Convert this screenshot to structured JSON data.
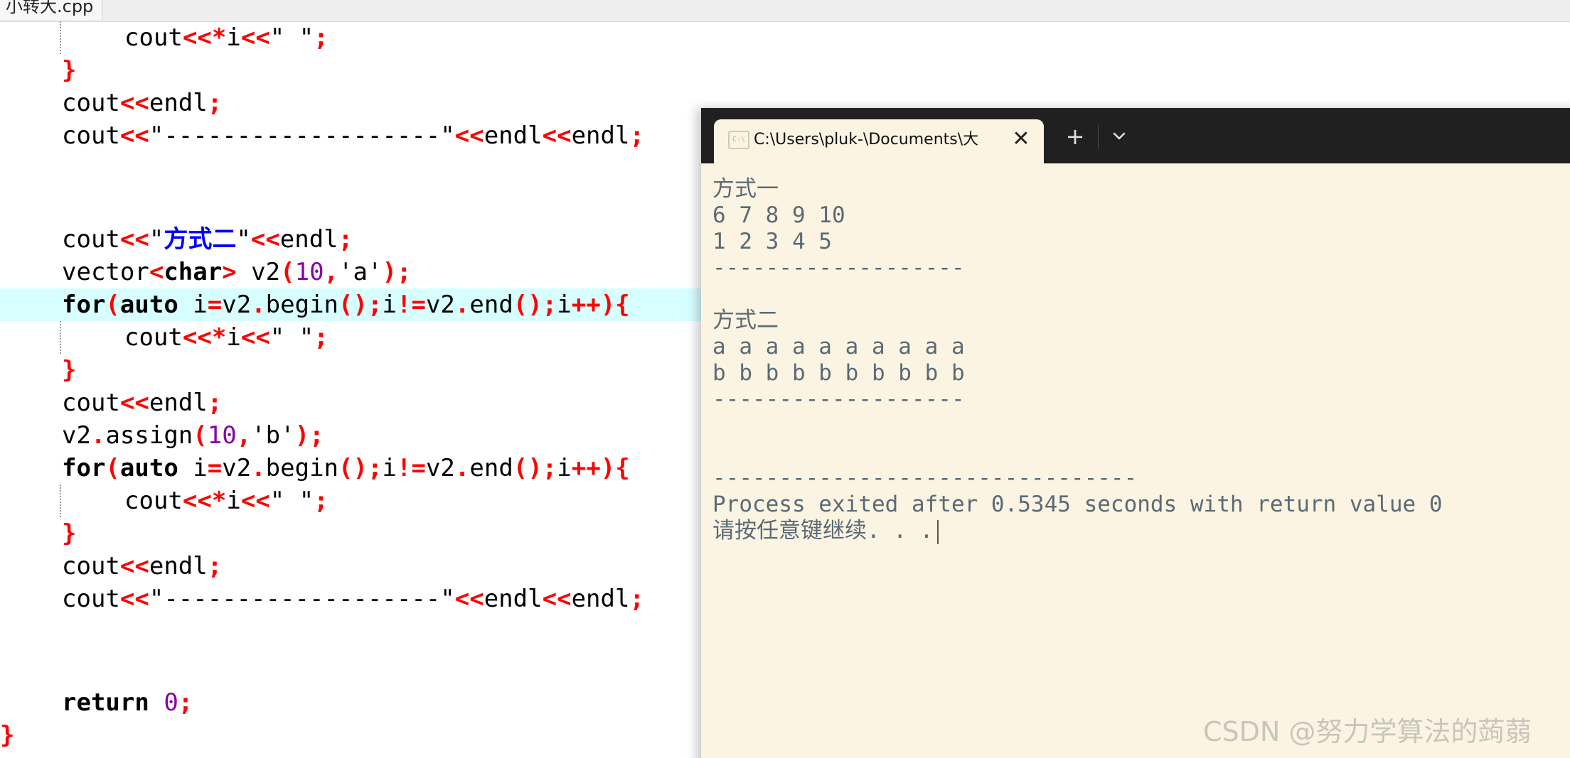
{
  "editor": {
    "file_tab": "小转大.cpp",
    "lines": [
      "cout<<*i<<\" \";",
      "}",
      "cout<<endl;",
      "cout<<\"-------------------\"<<endl<<endl;",
      "",
      "",
      "cout<<\"方式二\"<<endl;",
      "vector<char> v2(10,'a');",
      "for(auto i=v2.begin();i!=v2.end();i++){",
      "cout<<*i<<\" \";",
      "}",
      "cout<<endl;",
      "v2.assign(10,'b');",
      "for(auto i=v2.begin();i!=v2.end();i++){",
      "cout<<*i<<\" \";",
      "}",
      "cout<<endl;",
      "cout<<\"-------------------\"<<endl<<endl;",
      "",
      "",
      "return 0;",
      "}"
    ],
    "highlighted_line": 9
  },
  "terminal": {
    "tab_title": "C:\\Users\\pluk-\\Documents\\大",
    "tab_icon_text": "C:\\",
    "close_glyph": "✕",
    "new_tab_glyph": "+",
    "output": [
      "方式一",
      "6 7 8 9 10",
      "1 2 3 4 5",
      "-------------------",
      "",
      "方式二",
      "a a a a a a a a a a",
      "b b b b b b b b b b",
      "-------------------",
      "",
      "",
      "--------------------------------",
      "Process exited after 0.5345 seconds with return value 0",
      "请按任意键继续. . ."
    ]
  },
  "watermark": "CSDN @努力学算法的蒟蒻"
}
